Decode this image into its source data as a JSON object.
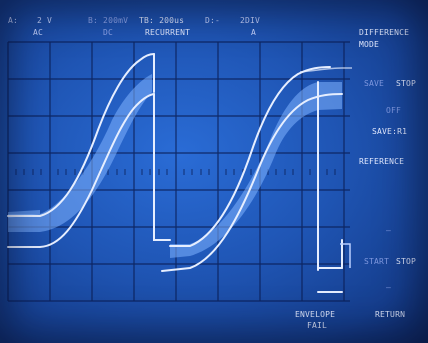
{
  "status": {
    "ch_a_label": "A:",
    "ch_a_volts": "2 V",
    "ch_a_coupling": "AC",
    "ch_b_volts": "B: 200mV",
    "ch_b_coupling": "DC",
    "timebase": "TB: 200us",
    "display": "D:-",
    "sweep_mode": "RECURRENT",
    "div": "2DIV",
    "div_channel": "A"
  },
  "menu": {
    "mode_line1": "DIFFERENCE",
    "mode_line2": "MODE",
    "save_label": "SAVE",
    "stop_label": "STOP",
    "off_label": "OFF",
    "save_r1_label": "SAVE:R1",
    "reference_label": "REFERENCE",
    "dash_1": "—",
    "start_label": "START",
    "stop2_label": "STOP",
    "dash_2": "—",
    "return_label": "RETURN"
  },
  "bottom": {
    "envelope_line1": "ENVELOPE",
    "envelope_line2": "FAIL"
  },
  "colors": {
    "screen": "#1f55b4",
    "trace": "#e6eeff",
    "band": "#7fb2ff",
    "grid": "#0b1f57"
  }
}
